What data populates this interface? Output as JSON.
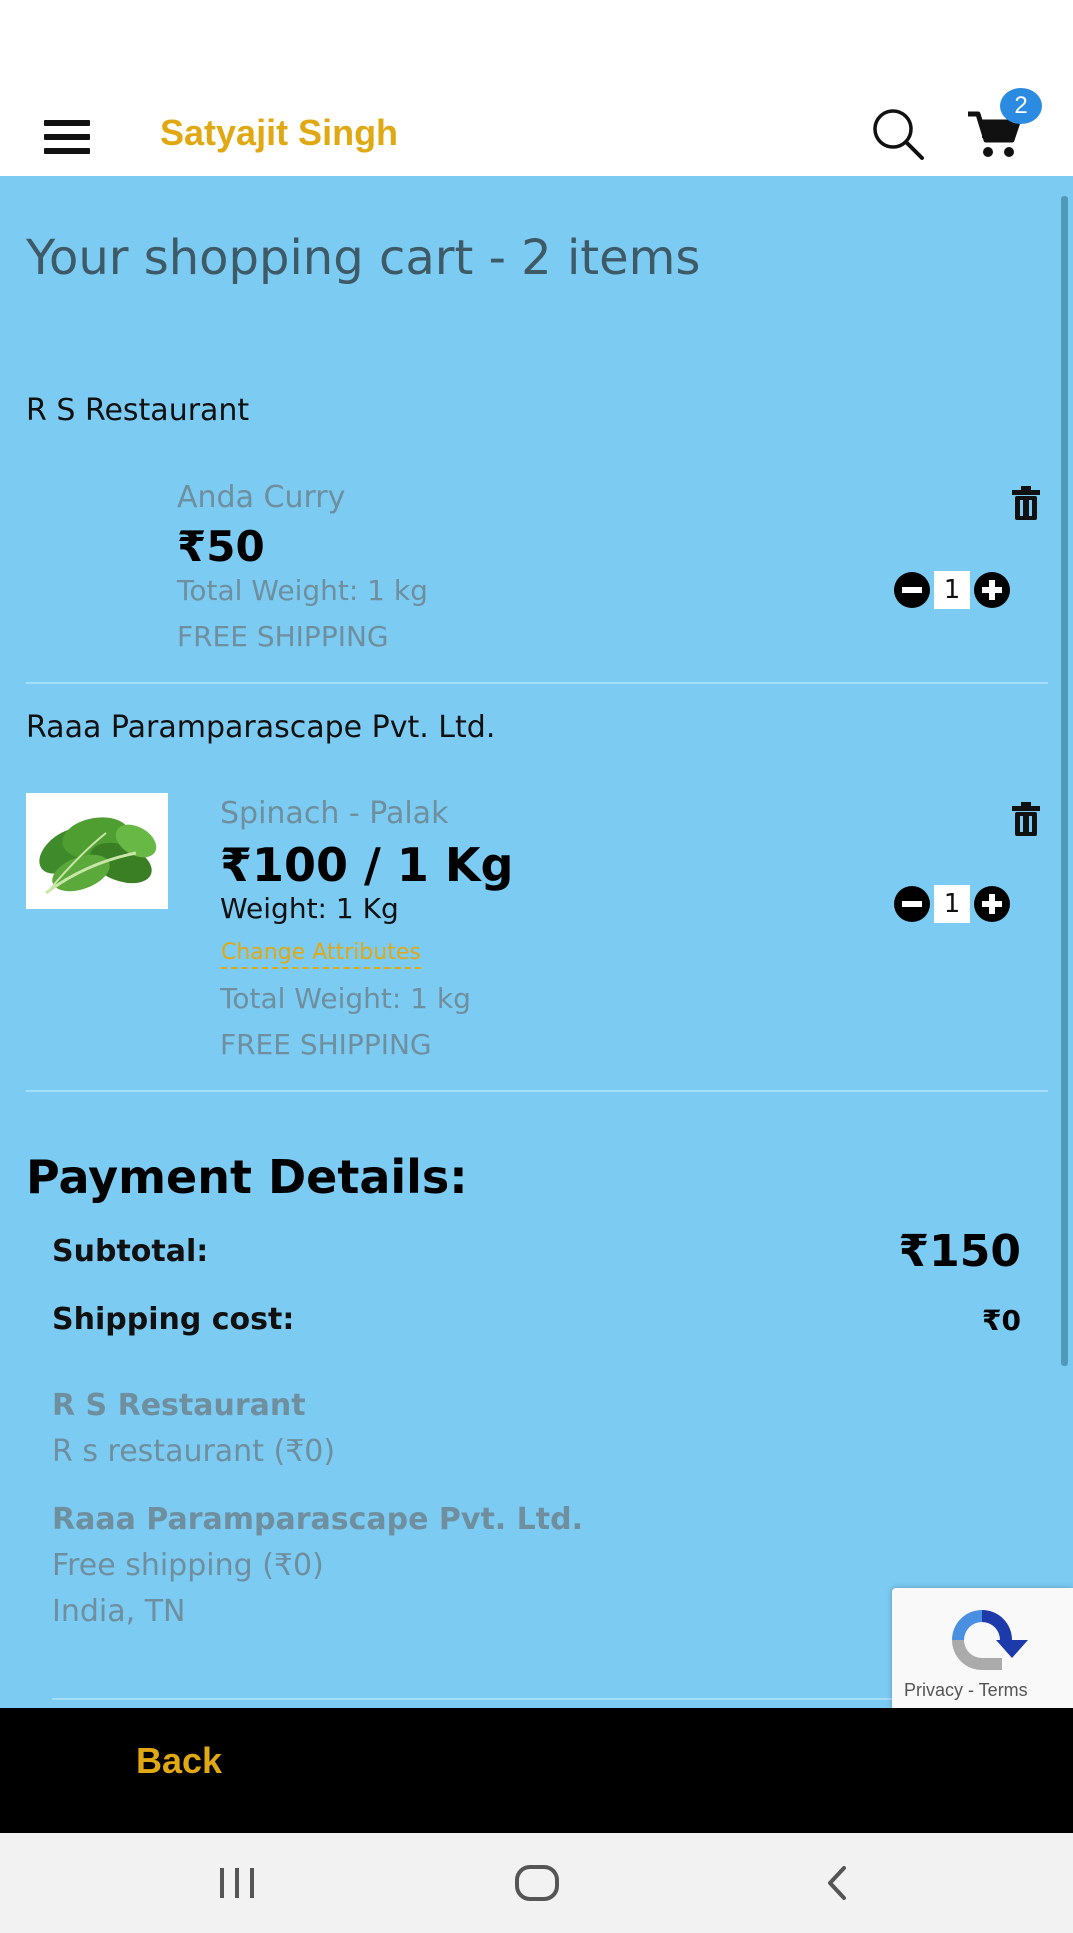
{
  "header": {
    "brand": "Satyajit Singh",
    "cart_count": "2",
    "icons": [
      "menu-icon",
      "search-icon",
      "cart-icon"
    ]
  },
  "cart": {
    "title": "Your shopping cart - 2 items",
    "stores": [
      {
        "name": "R S Restaurant",
        "items": [
          {
            "name": "Anda Curry",
            "price": "₹50",
            "total_weight": "Total Weight: 1 kg",
            "shipping": "FREE SHIPPING",
            "quantity": "1"
          }
        ]
      },
      {
        "name": "Raaa Paramparascape Pvt. Ltd.",
        "items": [
          {
            "name": "Spinach - Palak",
            "price": "₹100 / 1 Kg",
            "weight": "Weight: 1 Kg",
            "change_attributes": "Change Attributes",
            "total_weight": "Total Weight: 1 kg",
            "shipping": "FREE SHIPPING",
            "quantity": "1"
          }
        ]
      }
    ]
  },
  "payment": {
    "title": "Payment Details:",
    "subtotal_label": "Subtotal:",
    "subtotal_value": "₹150",
    "shipping_label": "Shipping cost:",
    "shipping_value": "₹0",
    "shipping_breakdown": [
      {
        "store": "R S Restaurant",
        "lines": [
          "R s restaurant (₹0)"
        ]
      },
      {
        "store": "Raaa Paramparascape Pvt. Ltd.",
        "lines": [
          "Free shipping (₹0)",
          "India, TN"
        ]
      }
    ]
  },
  "recaptcha": {
    "links": "Privacy - Terms"
  },
  "footer": {
    "back_label": "Back"
  },
  "colors": {
    "content_bg": "#7ccbf3",
    "accent": "#e0a813",
    "muted_text": "#6f8f9e",
    "badge": "#2b8be0",
    "footer_bg": "#000000"
  }
}
